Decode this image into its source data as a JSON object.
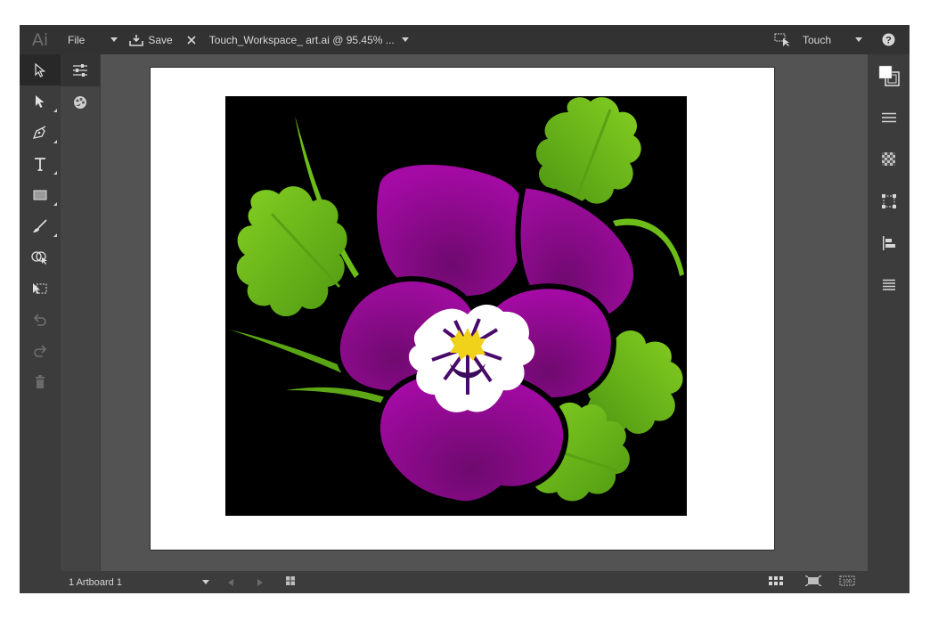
{
  "app": {
    "logo": "Ai"
  },
  "menubar": {
    "file_label": "File",
    "save_label": "Save",
    "document_title": "Touch_Workspace_ art.ai @ 95.45% ...",
    "workspace_label": "Touch"
  },
  "tools": [
    {
      "name": "selection-tool-icon",
      "active": true
    },
    {
      "name": "direct-selection-tool-icon"
    },
    {
      "name": "pen-tool-icon"
    },
    {
      "name": "type-tool-icon"
    },
    {
      "name": "rectangle-tool-icon"
    },
    {
      "name": "brush-tool-icon"
    },
    {
      "name": "shape-builder-tool-icon"
    },
    {
      "name": "transform-tool-icon"
    },
    {
      "name": "undo-icon",
      "disabled": true
    },
    {
      "name": "redo-icon",
      "disabled": true
    },
    {
      "name": "delete-icon",
      "disabled": true
    }
  ],
  "status": {
    "artboard_label": "1 Artboard 1"
  },
  "colors": {
    "petal": "#9a0a9a",
    "leaf": "#7cc51e",
    "center": "#f0d21a",
    "chrome_dark": "#323232",
    "chrome": "#535353"
  }
}
